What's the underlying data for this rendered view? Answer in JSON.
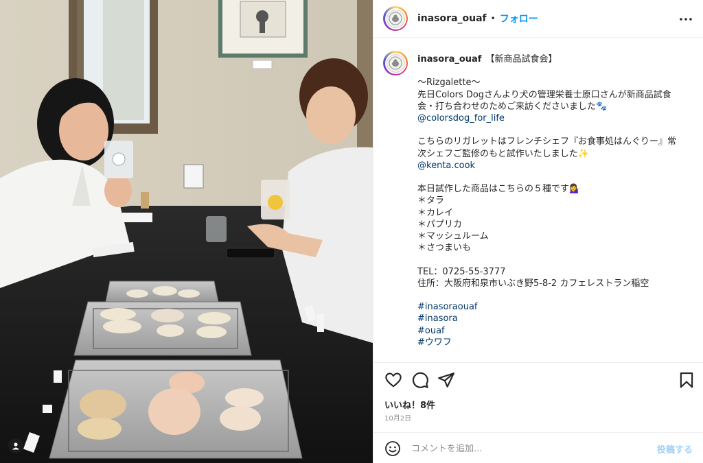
{
  "header": {
    "username": "inasora_ouaf",
    "separator": "•",
    "follow_label": "フォロー",
    "more_icon": "more-horizontal-icon"
  },
  "caption": {
    "username": "inasora_ouaf",
    "first_line": "【新商品試食会】",
    "lines": [
      {
        "text": "",
        "link": false
      },
      {
        "text": "〜Rizgalette〜",
        "link": false
      },
      {
        "text": "先日Colors Dogさんより犬の管理栄養士原口さんが新商品試食",
        "link": false
      },
      {
        "text": "会・打ち合わせのためご来訪くださいました🐾",
        "link": false
      },
      {
        "text": "@colorsdog_for_life",
        "link": true
      },
      {
        "text": "",
        "link": false
      },
      {
        "text": "こちらのリガレットはフレンチシェフ『お食事処はんぐりー』常",
        "link": false
      },
      {
        "text": "次シェフご監修のもと試作いたしました✨",
        "link": false
      },
      {
        "text": "@kenta.cook",
        "link": true
      },
      {
        "text": "",
        "link": false
      },
      {
        "text": "本日試作した商品はこちらの５種です💁‍♀️",
        "link": false
      },
      {
        "text": "＊タラ",
        "link": false
      },
      {
        "text": "＊カレイ",
        "link": false
      },
      {
        "text": "＊パプリカ",
        "link": false
      },
      {
        "text": "＊マッシュルーム",
        "link": false
      },
      {
        "text": "＊さつまいも",
        "link": false
      },
      {
        "text": "",
        "link": false
      },
      {
        "text": "TEL：0725-55-3777",
        "link": false
      },
      {
        "text": "住所：大阪府和泉市いぶき野5-8-2 カフェレストラン稲空",
        "link": false
      },
      {
        "text": "",
        "link": false
      },
      {
        "text": "#inasoraouaf",
        "link": true
      },
      {
        "text": "#inasora",
        "link": true
      },
      {
        "text": "#ouaf",
        "link": true
      },
      {
        "text": "#ウワフ",
        "link": true
      }
    ]
  },
  "actions": {
    "like_icon": "heart-icon",
    "comment_icon": "comment-icon",
    "share_icon": "share-icon",
    "save_icon": "bookmark-icon"
  },
  "likes_label": "いいね！8件",
  "date_label": "10月2日",
  "comment": {
    "placeholder": "コメントを追加...",
    "post_label": "投稿する",
    "emoji_icon": "emoji-icon"
  },
  "colors": {
    "link": "#00376b",
    "follow": "#0095f6",
    "post_disabled": "#a0cff8",
    "muted": "#8e8e8e",
    "text": "#262626"
  }
}
